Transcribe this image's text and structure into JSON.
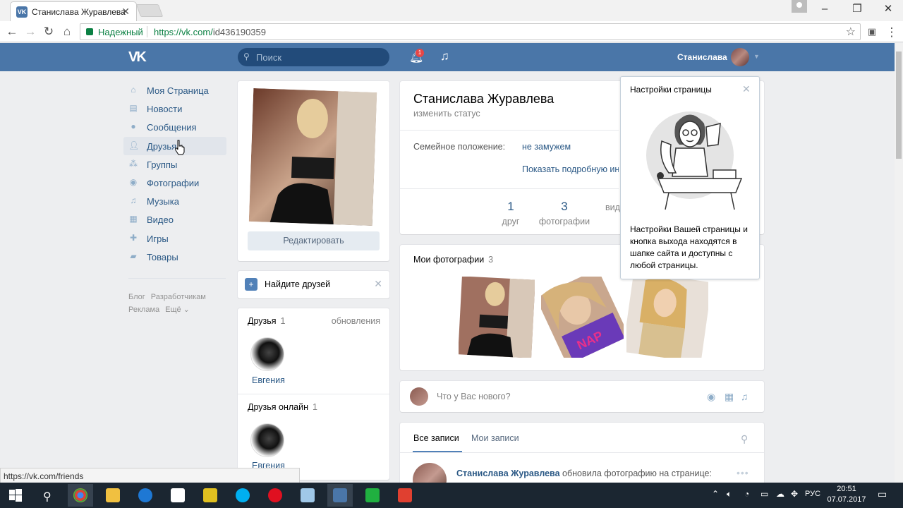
{
  "browser": {
    "tab_title": "Станислава Журавлева",
    "favicon": "vk-logo-icon",
    "omnibox": {
      "security_label": "Надежный",
      "url_host": "https://vk.com/",
      "url_path": "id436190359"
    },
    "status_url": "https://vk.com/friends"
  },
  "header": {
    "logo": "vk-logo",
    "search_placeholder": "Поиск",
    "notifications_count": "1",
    "user_name": "Станислава"
  },
  "sidebar": {
    "items": [
      {
        "label": "Моя Страница",
        "icon": "home-icon"
      },
      {
        "label": "Новости",
        "icon": "news-icon"
      },
      {
        "label": "Сообщения",
        "icon": "messages-icon"
      },
      {
        "label": "Друзья",
        "icon": "friends-icon"
      },
      {
        "label": "Группы",
        "icon": "groups-icon"
      },
      {
        "label": "Фотографии",
        "icon": "camera-icon"
      },
      {
        "label": "Музыка",
        "icon": "music-icon"
      },
      {
        "label": "Видео",
        "icon": "video-icon"
      },
      {
        "label": "Игры",
        "icon": "games-icon"
      },
      {
        "label": "Товары",
        "icon": "shop-icon"
      }
    ],
    "footer": {
      "blog": "Блог",
      "developers": "Разработчикам",
      "ads": "Реклама",
      "more": "Ещё ⌄"
    }
  },
  "left_column": {
    "edit_button": "Редактировать",
    "find_friends": "Найдите друзей",
    "friends_title": "Друзья",
    "friends_count": "1",
    "friends_updates": "обновления",
    "friend_name": "Евгения",
    "online_title": "Друзья онлайн",
    "online_count": "1",
    "online_friend_name": "Евгения"
  },
  "profile": {
    "name": "Станислава Журавлева",
    "status_prompt": "изменить статус",
    "marital_label": "Семейное положение:",
    "marital_value": "не замужем",
    "show_more": "Показать подробную информацию",
    "stats": [
      {
        "num": "1",
        "label": "друг"
      },
      {
        "num": "3",
        "label": "фотографии"
      },
      {
        "num": "",
        "label": "видео"
      }
    ]
  },
  "photos": {
    "title": "Мои фотографии",
    "count": "3"
  },
  "post_box": {
    "placeholder": "Что у Вас нового?"
  },
  "wall": {
    "tab_all": "Все записи",
    "tab_mine": "Мои записи",
    "post_author": "Станислава Журавлева",
    "post_action": "обновила фотографию на странице:"
  },
  "popup": {
    "title": "Настройки страницы",
    "text": "Настройки Вашей страницы и кнопка выхода находятся в шапке сайта и доступны с любой страницы."
  },
  "taskbar": {
    "lang": "РУС",
    "time": "20:51",
    "date": "07.07.2017"
  },
  "colors": {
    "vk_blue": "#4a76a8",
    "link": "#2a5885",
    "bg": "#edeef0"
  }
}
